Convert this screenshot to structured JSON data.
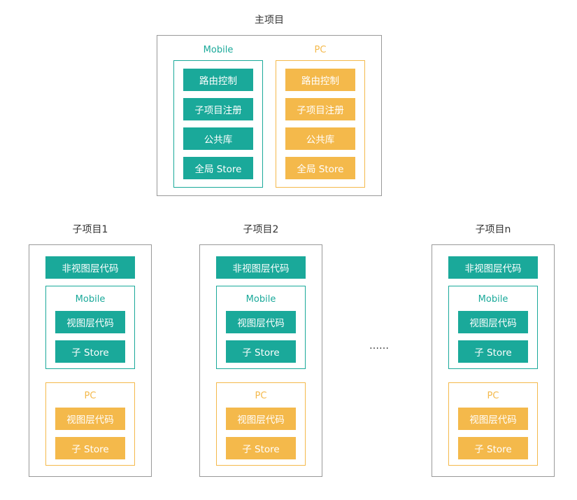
{
  "colors": {
    "mobile": "#1aa99a",
    "pc": "#f4b94b",
    "frame": "#999999",
    "text": "#333333"
  },
  "main_project": {
    "title": "主项目",
    "groups": [
      {
        "label": "Mobile",
        "theme": "teal",
        "items": [
          "路由控制",
          "子项目注册",
          "公共库",
          "全局 Store"
        ]
      },
      {
        "label": "PC",
        "theme": "orange",
        "items": [
          "路由控制",
          "子项目注册",
          "公共库",
          "全局 Store"
        ]
      }
    ]
  },
  "sub_projects": [
    {
      "title": "子项目1",
      "shared_block": "非视图层代码",
      "groups": [
        {
          "label": "Mobile",
          "theme": "teal",
          "items": [
            "视图层代码",
            "子 Store"
          ]
        },
        {
          "label": "PC",
          "theme": "orange",
          "items": [
            "视图层代码",
            "子 Store"
          ]
        }
      ]
    },
    {
      "title": "子项目2",
      "shared_block": "非视图层代码",
      "groups": [
        {
          "label": "Mobile",
          "theme": "teal",
          "items": [
            "视图层代码",
            "子 Store"
          ]
        },
        {
          "label": "PC",
          "theme": "orange",
          "items": [
            "视图层代码",
            "子 Store"
          ]
        }
      ]
    },
    {
      "title": "子项目n",
      "shared_block": "非视图层代码",
      "groups": [
        {
          "label": "Mobile",
          "theme": "teal",
          "items": [
            "视图层代码",
            "子 Store"
          ]
        },
        {
          "label": "PC",
          "theme": "orange",
          "items": [
            "视图层代码",
            "子 Store"
          ]
        }
      ]
    }
  ],
  "ellipsis": "……"
}
